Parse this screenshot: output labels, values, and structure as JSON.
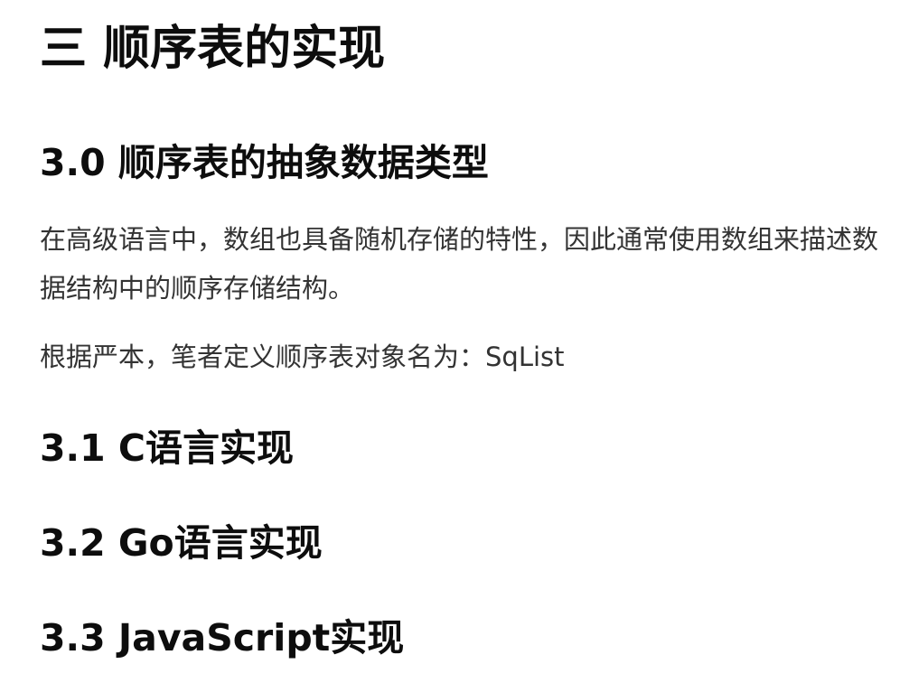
{
  "doc": {
    "title": "三 顺序表的实现",
    "sections": [
      {
        "heading": "3.0 顺序表的抽象数据类型"
      },
      {
        "heading": "3.1 C语言实现"
      },
      {
        "heading": "3.2 Go语言实现"
      },
      {
        "heading": "3.3 JavaScript实现"
      }
    ],
    "paragraphs": [
      "在高级语言中，数组也具备随机存储的特性，因此通常使用数组来描述数据结构中的顺序存储结构。",
      "根据严本，笔者定义顺序表对象名为：SqList"
    ]
  }
}
